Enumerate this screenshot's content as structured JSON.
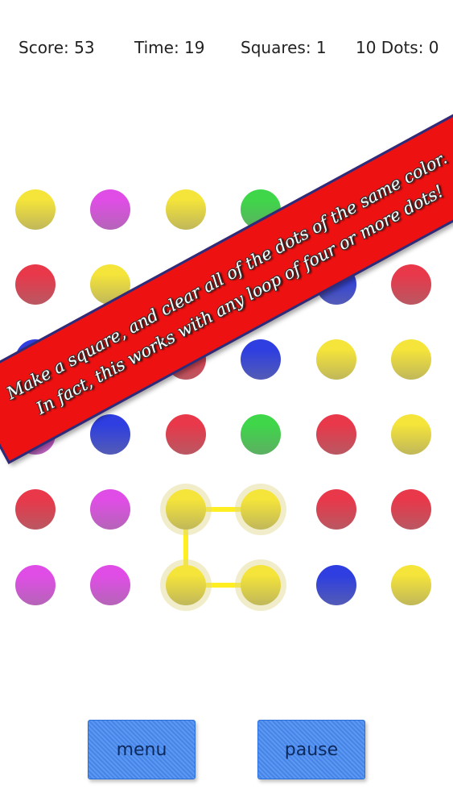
{
  "stats": {
    "score": "Score: 53",
    "time": "Time: 19",
    "squares": "Squares: 1",
    "ten_dots": "10 Dots: 0"
  },
  "colors": {
    "yellow": "#f5e43a",
    "magenta": "#e04de6",
    "green": "#3fd64a",
    "red": "#e8384a",
    "blue": "#2e3ee0"
  },
  "board": {
    "rows": [
      [
        "yellow",
        "magenta",
        "yellow",
        "green",
        "red",
        "magenta"
      ],
      [
        "red",
        "yellow",
        "red",
        "green",
        "blue",
        "red"
      ],
      [
        "blue",
        "blue",
        "red",
        "blue",
        "yellow",
        "yellow"
      ],
      [
        "magenta",
        "blue",
        "red",
        "green",
        "red",
        "yellow"
      ],
      [
        "red",
        "magenta",
        "yellow",
        "yellow",
        "red",
        "red"
      ],
      [
        "magenta",
        "magenta",
        "yellow",
        "yellow",
        "blue",
        "yellow"
      ]
    ],
    "selected_path": [
      [
        4,
        3
      ],
      [
        4,
        2
      ],
      [
        5,
        2
      ],
      [
        5,
        3
      ]
    ],
    "link_color": "#ffee22"
  },
  "banner": {
    "line1": "Make a square, and clear all of the dots of the same color.",
    "line2": "In fact, this works with any loop of four or more dots!"
  },
  "buttons": {
    "menu": "menu",
    "pause": "pause"
  }
}
